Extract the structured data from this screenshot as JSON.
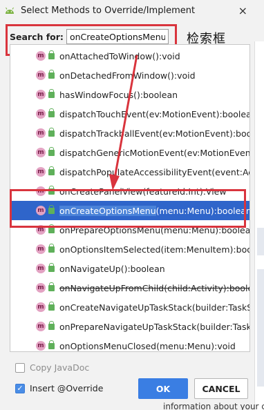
{
  "window": {
    "title": "Select Methods to Override/Implement",
    "close_glyph": "×",
    "app_icon": "android-icon"
  },
  "search": {
    "label": "Search for:",
    "value": "onCreateOptionsMenu"
  },
  "annotation": {
    "text": "检索框",
    "color": "#d9343d"
  },
  "methods": [
    {
      "text": "onAttachedToWindow():void",
      "strike": false,
      "selected": false
    },
    {
      "text": "onDetachedFromWindow():void",
      "strike": false,
      "selected": false
    },
    {
      "text": "hasWindowFocus():boolean",
      "strike": false,
      "selected": false
    },
    {
      "text": "dispatchTouchEvent(ev:MotionEvent):boolean",
      "strike": false,
      "selected": false
    },
    {
      "text": "dispatchTrackballEvent(ev:MotionEvent):boolean",
      "strike": false,
      "selected": false
    },
    {
      "text": "dispatchGenericMotionEvent(ev:MotionEvent):boolean",
      "strike": false,
      "selected": false
    },
    {
      "text": "dispatchPopulateAccessibilityEvent(event:AccessibilityEvent):boolean",
      "strike": false,
      "selected": false
    },
    {
      "text": "onCreatePanelView(featureId:Int):View",
      "strike": false,
      "selected": false
    },
    {
      "text": "onCreateOptionsMenu(menu:Menu):boolean",
      "strike": false,
      "selected": true
    },
    {
      "text": "onPrepareOptionsMenu(menu:Menu):boolean",
      "strike": false,
      "selected": false
    },
    {
      "text": "onOptionsItemSelected(item:MenuItem):boolean",
      "strike": false,
      "selected": false
    },
    {
      "text": "onNavigateUp():boolean",
      "strike": false,
      "selected": false
    },
    {
      "text": "onNavigateUpFromChild(child:Activity):boolean",
      "strike": true,
      "selected": false
    },
    {
      "text": "onCreateNavigateUpTaskStack(builder:TaskStackBuilder):void",
      "strike": false,
      "selected": false
    },
    {
      "text": "onPrepareNavigateUpTaskStack(builder:TaskStackBuilder):void",
      "strike": false,
      "selected": false
    },
    {
      "text": "onOptionsMenuClosed(menu:Menu):void",
      "strike": false,
      "selected": false
    }
  ],
  "selected_highlight": "onCreateOptionsMenu",
  "selected_rest": "(menu:Menu):boolean",
  "options": {
    "copy_javadoc": {
      "label": "Copy JavaDoc",
      "checked": false
    },
    "insert_override": {
      "label": "Insert @Override",
      "checked": true
    }
  },
  "buttons": {
    "ok": "OK",
    "cancel": "CANCEL"
  },
  "background_text": "information about your c",
  "colors": {
    "selection": "#2f65ca",
    "annotation": "#d9343d",
    "ok_button": "#3a7ee3"
  }
}
